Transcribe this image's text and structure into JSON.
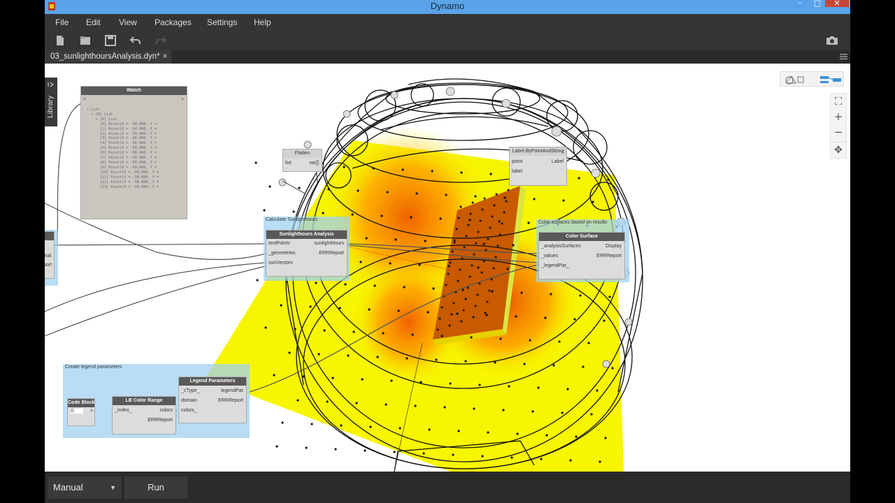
{
  "window": {
    "title": "Dynamo"
  },
  "menu": {
    "items": [
      "File",
      "Edit",
      "View",
      "Packages",
      "Settings",
      "Help"
    ]
  },
  "tab": {
    "label": "03_sunlighthoursAnalysis.dyn*",
    "close": "×"
  },
  "library": {
    "label": "Library"
  },
  "groups": {
    "sunlight": "Calculate Sunlighthours",
    "color": "Color surfaces based on results",
    "legend": "Create legend parameters"
  },
  "nodes": {
    "watch": {
      "title": "Watch"
    },
    "flatten": {
      "title": "Flatten",
      "in": "list",
      "out": "var[]"
    },
    "label": {
      "title": "Label.ByPointAndString",
      "in1": "point",
      "in2": "label",
      "out": "Label"
    },
    "sunlight": {
      "title": "Sunlighthours Analysis",
      "in1": "testPoints",
      "in2": "_geometries",
      "in3": "sunVectors",
      "out1": "sunlightHours",
      "out2": "ERRReport"
    },
    "color_surface": {
      "title": "Color Surface",
      "in1": "_analysisSurfaces",
      "in2": "_values",
      "in3": "_legendPar_",
      "out1": "Display",
      "out2": "ERRReport"
    },
    "code_block": {
      "title": "Code Block",
      "value": "0;"
    },
    "lb_color_range": {
      "title": "LB Color Range",
      "in": "_index_",
      "out1": "colors",
      "out2": "ERRReport"
    },
    "legend_params": {
      "title": "Legend Parameters",
      "in1": "_cType_",
      "in2": "domain",
      "in3": "colors_",
      "out1": "legendPar",
      "out2": "ERRReport"
    },
    "left_partial": {
      "line1": "mal",
      "line2": "port"
    }
  },
  "watch_lines": [
    "▾ List",
    "  ▾ [0] List",
    "    ▾ [0] List",
    "      [0] Point(X = -58.000, Y = ",
    "      [1] Point(X = -54.000, Y = ",
    "      [2] Point(X = -50.000, Y = ",
    "      [3] Point(X = -46.000, Y = ",
    "      [4] Point(X = -58.000, Y = ",
    "      [5] Point(X = -58.000, Y = ",
    "      [6] Point(X = -58.000, Y = ",
    "      [7] Point(X = -58.000, Y = ",
    "      [8] Point(X = -58.000, Y = ",
    "      [9] Point(X = -58.000, Y = ",
    "      [10] Point(X = -58.000, Y = ",
    "      [11] Point(X = -58.000, Y = ",
    "      [12] Point(X = -58.000, Y = ",
    "      [13] Point(X = -58.000, Y = "
  ],
  "bottom": {
    "run_mode": "Manual",
    "run_label": "Run"
  },
  "colors": {
    "titlebar": "#5aa3e8",
    "group": "#a0d2f0",
    "surface": "#f7f500",
    "heat": "#ff5a00"
  }
}
